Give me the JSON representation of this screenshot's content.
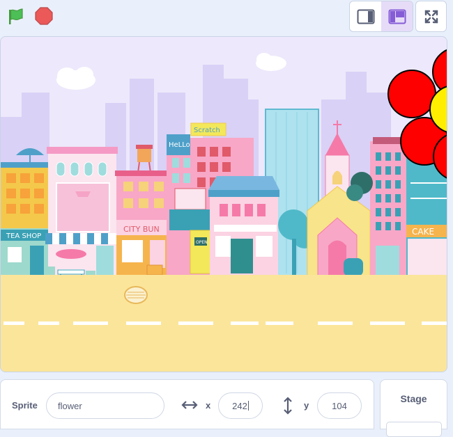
{
  "controls": {
    "green_flag_icon": "green-flag-icon",
    "stop_icon": "stop-sign-icon",
    "small_stage_icon": "small-stage-icon",
    "large_stage_icon": "large-stage-icon",
    "fullscreen_icon": "fullscreen-icon"
  },
  "stage": {
    "backdrop": "city backdrop",
    "signs": {
      "tea_shop": "TEA SHOP",
      "hello": "HeLLo",
      "scratch": "Scratch",
      "city_bun": "CITY BUN",
      "cake": "CAKE",
      "open": "OPEN"
    }
  },
  "sprite_info": {
    "sprite_label": "Sprite",
    "sprite_name": "flower",
    "x_label": "x",
    "x_value": "242",
    "y_label": "y",
    "y_value": "104"
  },
  "stage_panel": {
    "label": "Stage"
  },
  "colors": {
    "accent": "#855cd6",
    "flag_green": "#4cbf56",
    "stop_red": "#ec5959",
    "flower_red": "#ff0000",
    "flower_center": "#ffee00"
  }
}
